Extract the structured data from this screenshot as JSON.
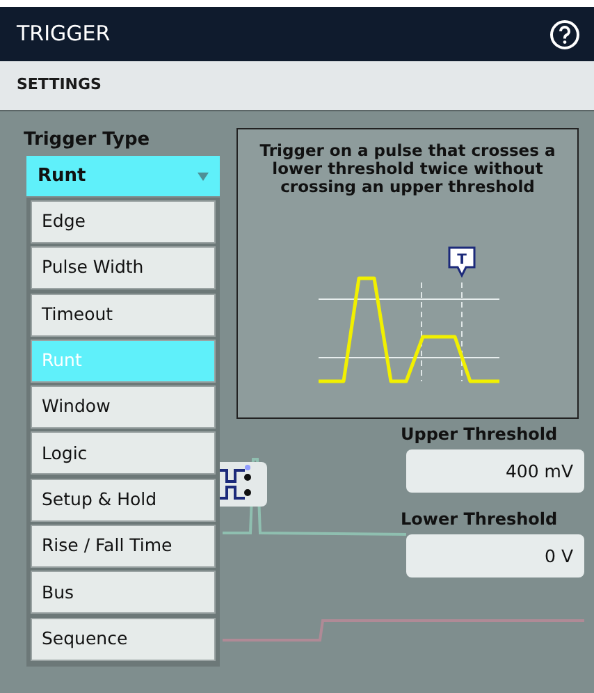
{
  "panel": {
    "title": "TRIGGER"
  },
  "tab": "SETTINGS",
  "trigger_type": {
    "label": "Trigger Type",
    "value": "Runt",
    "expanded": true
  },
  "options": [
    {
      "label": "Edge",
      "selected": false
    },
    {
      "label": "Pulse Width",
      "selected": false
    },
    {
      "label": "Timeout",
      "selected": false
    },
    {
      "label": "Runt",
      "selected": true
    },
    {
      "label": "Window",
      "selected": false
    },
    {
      "label": "Logic",
      "selected": false
    },
    {
      "label": "Setup & Hold",
      "selected": false
    },
    {
      "label": "Rise / Fall Time",
      "selected": false
    },
    {
      "label": "Bus",
      "selected": false
    },
    {
      "label": "Sequence",
      "selected": false
    }
  ],
  "description": "Trigger on a pulse that crosses a lower threshold twice without crossing an upper threshold",
  "upper_threshold": {
    "label": "Upper Threshold",
    "value": "400 mV"
  },
  "lower_threshold": {
    "label": "Lower Threshold",
    "value": "0 V"
  },
  "trigger_marker": "T"
}
